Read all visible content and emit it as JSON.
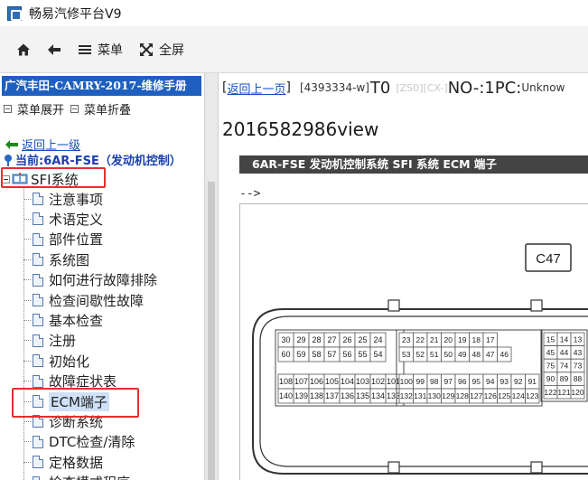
{
  "window": {
    "title": "畅易汽修平台V9"
  },
  "toolbar": {
    "home_label": "",
    "back_label": "",
    "menu_label": "菜单",
    "fullscreen_label": "全屏"
  },
  "left_panel": {
    "manual_title": "广汽丰田-CAMRY-2017-维修手册",
    "expand_menu": "菜单展开",
    "collapse_menu": "菜单折叠",
    "back_link": "返回上一级",
    "current_label": "当前:6AR-FSE（发动机控制）",
    "tree_root": "SFI系统",
    "tree_items": [
      "注意事项",
      "术语定义",
      "部件位置",
      "系统图",
      "如何进行故障排除",
      "检查间歇性故障",
      "基本检查",
      "注册",
      "初始化",
      "故障症状表",
      "ECM端子",
      "诊断系统",
      "DTC检查/清除",
      "定格数据",
      "检查模式程序"
    ],
    "selected_item": "ECM端子"
  },
  "content": {
    "back_link": "返回上一页",
    "doc_code": "[4393334-w]",
    "t0": "T0",
    "faded_tags": "[ZS0][CX-]",
    "no_pc": "NO-:1PC:",
    "unknown": "Unknow",
    "view_id": "2016582986view",
    "banner": "6AR-FSE 发动机控制系统  SFI 系统  ECM 端子",
    "arrow_text": "-->"
  },
  "diagram": {
    "connector_label": "C47",
    "left_block": {
      "rows": [
        [
          "30",
          "29",
          "28",
          "27",
          "26",
          "25",
          "24"
        ],
        [
          "60",
          "59",
          "58",
          "57",
          "56",
          "55",
          "54"
        ],
        [
          "108",
          "107",
          "106",
          "105",
          "104",
          "103",
          "102",
          "101"
        ],
        [
          "140",
          "139",
          "138",
          "137",
          "136",
          "135",
          "134",
          "133"
        ]
      ]
    },
    "mid_block": {
      "rows": [
        [
          "23",
          "22",
          "21",
          "20",
          "19",
          "18",
          "17"
        ],
        [
          "53",
          "52",
          "51",
          "50",
          "49",
          "48",
          "47",
          "46"
        ],
        [
          "100",
          "99",
          "98",
          "97",
          "96",
          "95",
          "94",
          "93",
          "92",
          "91"
        ],
        [
          "132",
          "131",
          "130",
          "129",
          "128",
          "127",
          "126",
          "125",
          "124",
          "123"
        ]
      ]
    },
    "right_block": {
      "rows": [
        [
          "15",
          "14",
          "13"
        ],
        [
          "45",
          "44",
          "43"
        ],
        [
          "75",
          "74",
          "73"
        ],
        [
          "90",
          "89",
          "88"
        ],
        [
          "122",
          "121",
          "120"
        ]
      ]
    }
  },
  "colors": {
    "manual_title_bg": "#1f5fbf",
    "highlight_box": "#e23030",
    "banner_bg": "#444444",
    "link": "#1550c0"
  }
}
